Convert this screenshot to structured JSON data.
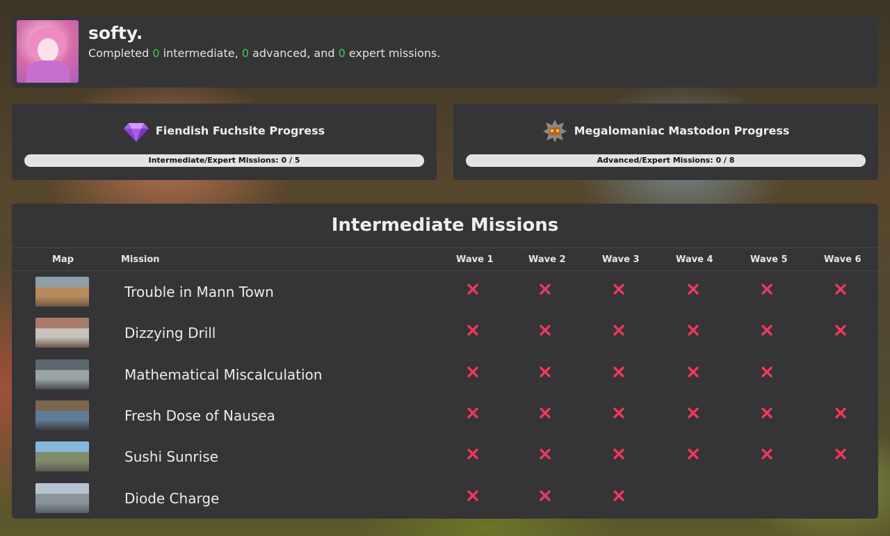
{
  "profile": {
    "username": "softy.",
    "summary": {
      "prefix": "Completed ",
      "intermediate_count": "0",
      "mid1": " intermediate, ",
      "advanced_count": "0",
      "mid2": " advanced, and ",
      "expert_count": "0",
      "suffix": " expert missions."
    }
  },
  "progress": [
    {
      "title": "Fiendish Fuchsite Progress",
      "icon": "purple-gem-icon",
      "bar_label": "Intermediate/Expert Missions: 0 / 5",
      "completed": 0,
      "total": 5
    },
    {
      "title": "Megalomaniac Mastodon Progress",
      "icon": "mastodon-robot-icon",
      "bar_label": "Advanced/Expert Missions: 0 / 8",
      "completed": 0,
      "total": 8
    }
  ],
  "missions": {
    "heading": "Intermediate Missions",
    "columns": {
      "map": "Map",
      "mission": "Mission",
      "waves": [
        "Wave 1",
        "Wave 2",
        "Wave 3",
        "Wave 4",
        "Wave 5",
        "Wave 6"
      ]
    },
    "status_icon": "x-mark-icon",
    "colors": {
      "incomplete": "#f0375e",
      "progress_fill": "#7f55c8",
      "count": "#3ecb5d"
    },
    "rows": [
      {
        "name": "Trouble in Mann Town",
        "waves": 6,
        "thumb": [
          "#8e9fa8",
          "#b98a5c",
          "#6f5a44"
        ]
      },
      {
        "name": "Dizzying Drill",
        "waves": 6,
        "thumb": [
          "#a87a68",
          "#c7c2bc",
          "#6b5547"
        ]
      },
      {
        "name": "Mathematical Miscalculation",
        "waves": 5,
        "thumb": [
          "#5d6770",
          "#9aa3a6",
          "#4a4f52"
        ]
      },
      {
        "name": "Fresh Dose of Nausea",
        "waves": 6,
        "thumb": [
          "#7d6650",
          "#5d7d97",
          "#3b3a3a"
        ]
      },
      {
        "name": "Sushi Sunrise",
        "waves": 6,
        "thumb": [
          "#86b7dc",
          "#7d8c6a",
          "#5e5a52"
        ]
      },
      {
        "name": "Diode Charge",
        "waves": 3,
        "thumb": [
          "#b7c3cf",
          "#8a949b",
          "#585f63"
        ]
      }
    ]
  }
}
